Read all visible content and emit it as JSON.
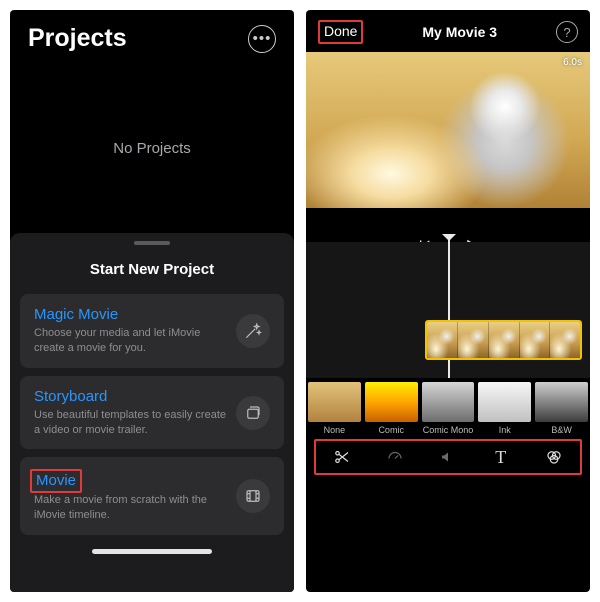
{
  "left": {
    "title": "Projects",
    "empty_label": "No Projects",
    "sheet": {
      "title": "Start New Project",
      "options": [
        {
          "title": "Magic Movie",
          "desc": "Choose your media and let iMovie create a movie for you.",
          "icon": "wand-icon"
        },
        {
          "title": "Storyboard",
          "desc": "Use beautiful templates to easily create a video or movie trailer.",
          "icon": "cards-icon"
        },
        {
          "title": "Movie",
          "desc": "Make a movie from scratch with the iMovie timeline.",
          "icon": "film-icon"
        }
      ]
    }
  },
  "right": {
    "done_label": "Done",
    "title": "My Movie 3",
    "timestamp": "6.0s",
    "filters": [
      {
        "label": "None",
        "style": "thumb-none"
      },
      {
        "label": "Comic",
        "style": "thumb-comic"
      },
      {
        "label": "Comic Mono",
        "style": "thumb-comicmono"
      },
      {
        "label": "Ink",
        "style": "thumb-ink"
      },
      {
        "label": "B&W",
        "style": "thumb-bw"
      }
    ],
    "tools": [
      "scissors",
      "speed",
      "volume",
      "text",
      "filter"
    ]
  }
}
